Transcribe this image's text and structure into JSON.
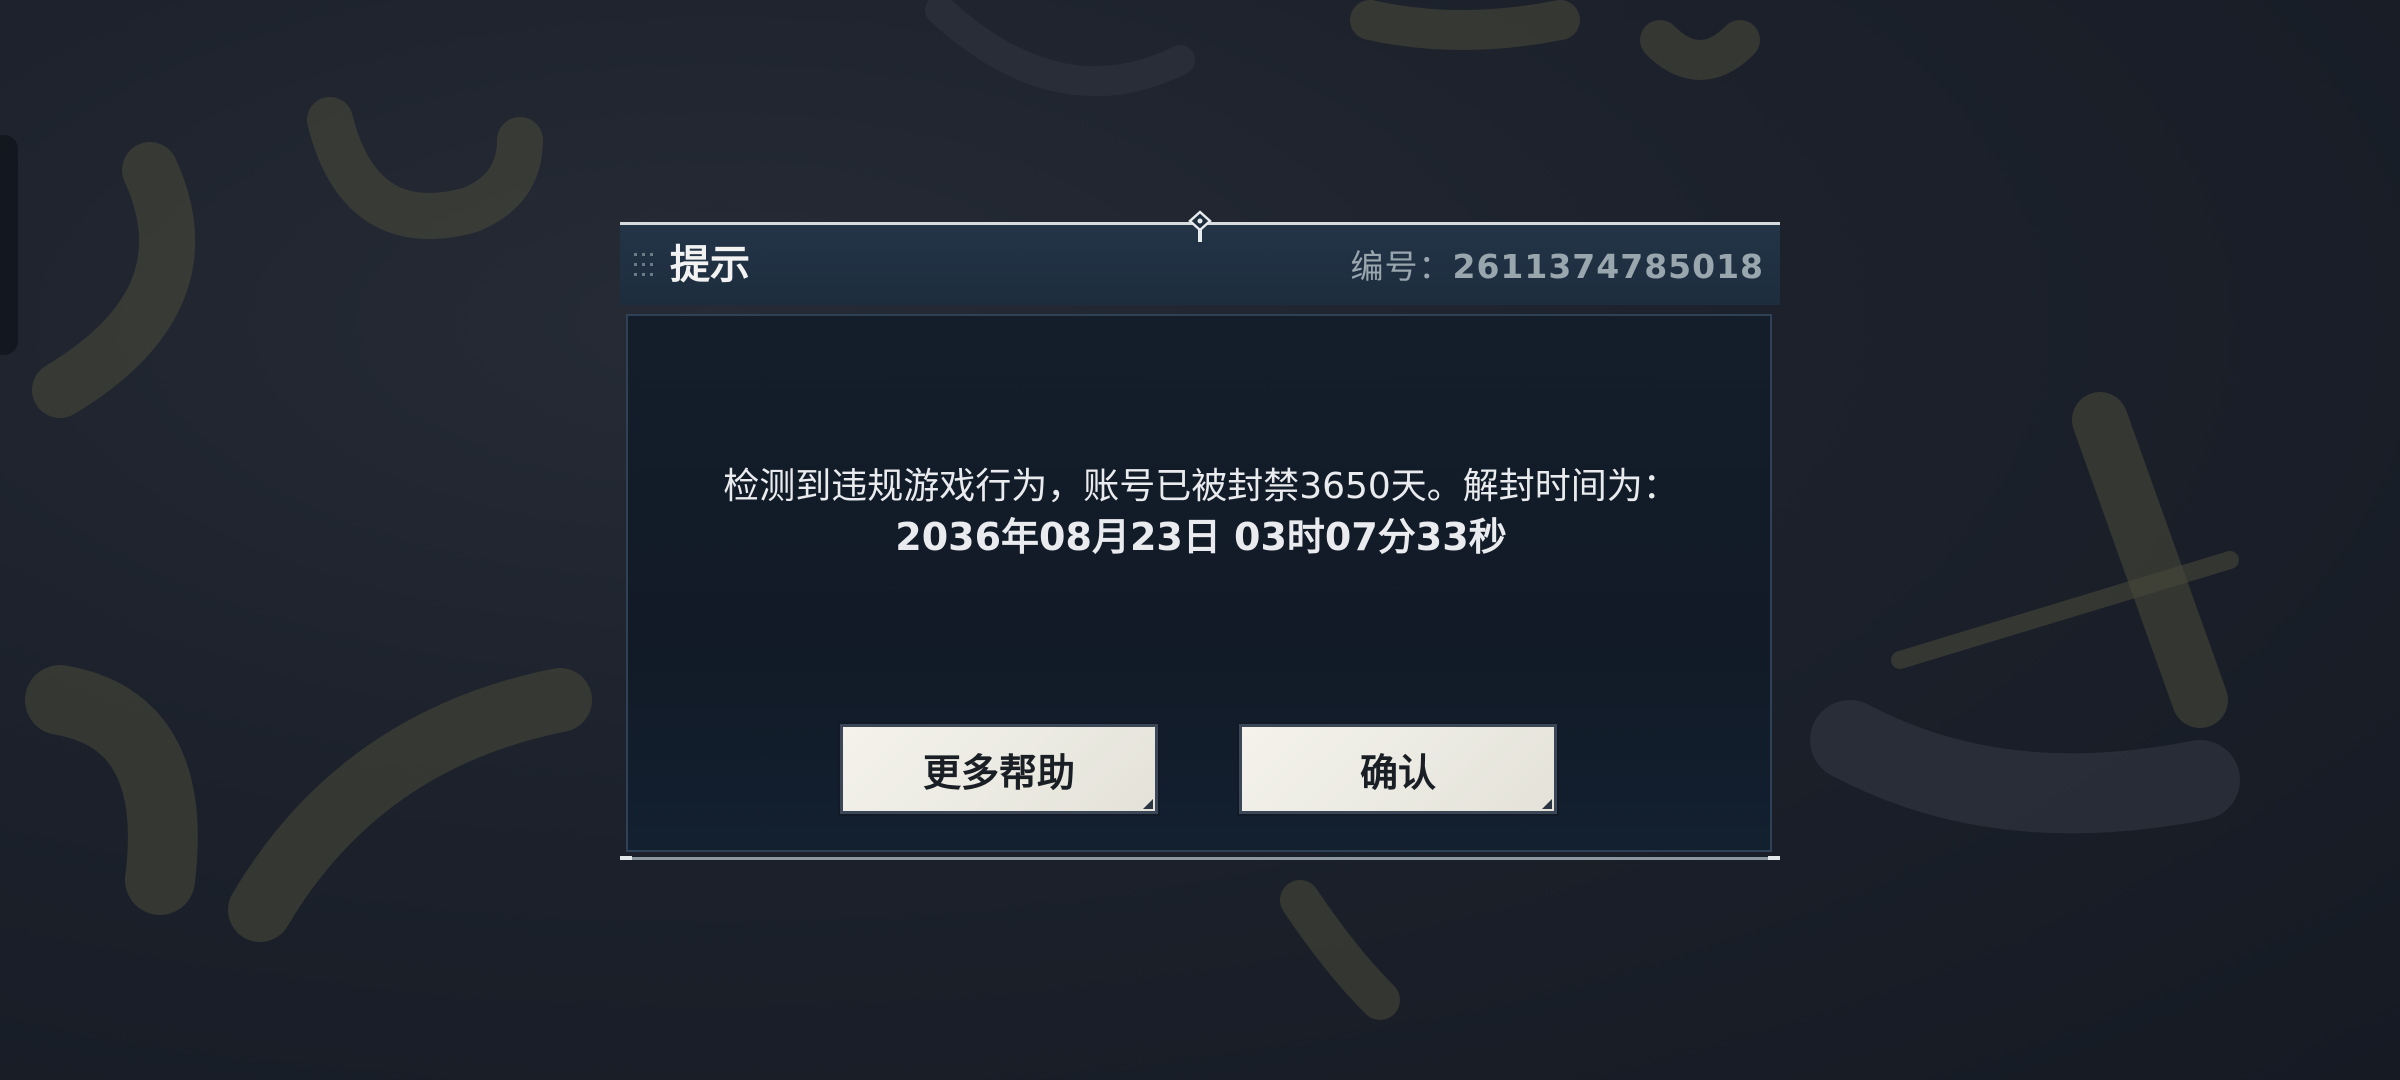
{
  "dialog": {
    "title": "提示",
    "serial_label": "编号：",
    "serial_number": "2611374785018",
    "message_line1": "检测到违规游戏行为，账号已被封禁3650天。解封时间为：",
    "message_line2": "2036年08月23日 03时07分33秒",
    "buttons": {
      "help_label": "更多帮助",
      "confirm_label": "确认"
    }
  },
  "icons": {
    "grip": "grip-dots-icon",
    "pin": "pin-icon"
  },
  "colors": {
    "header_bg": "#233447",
    "body_bg": "#141e2b",
    "button_bg": "#f4f2ea",
    "text_primary": "#e9ebee",
    "text_muted": "#9aa6ae"
  }
}
